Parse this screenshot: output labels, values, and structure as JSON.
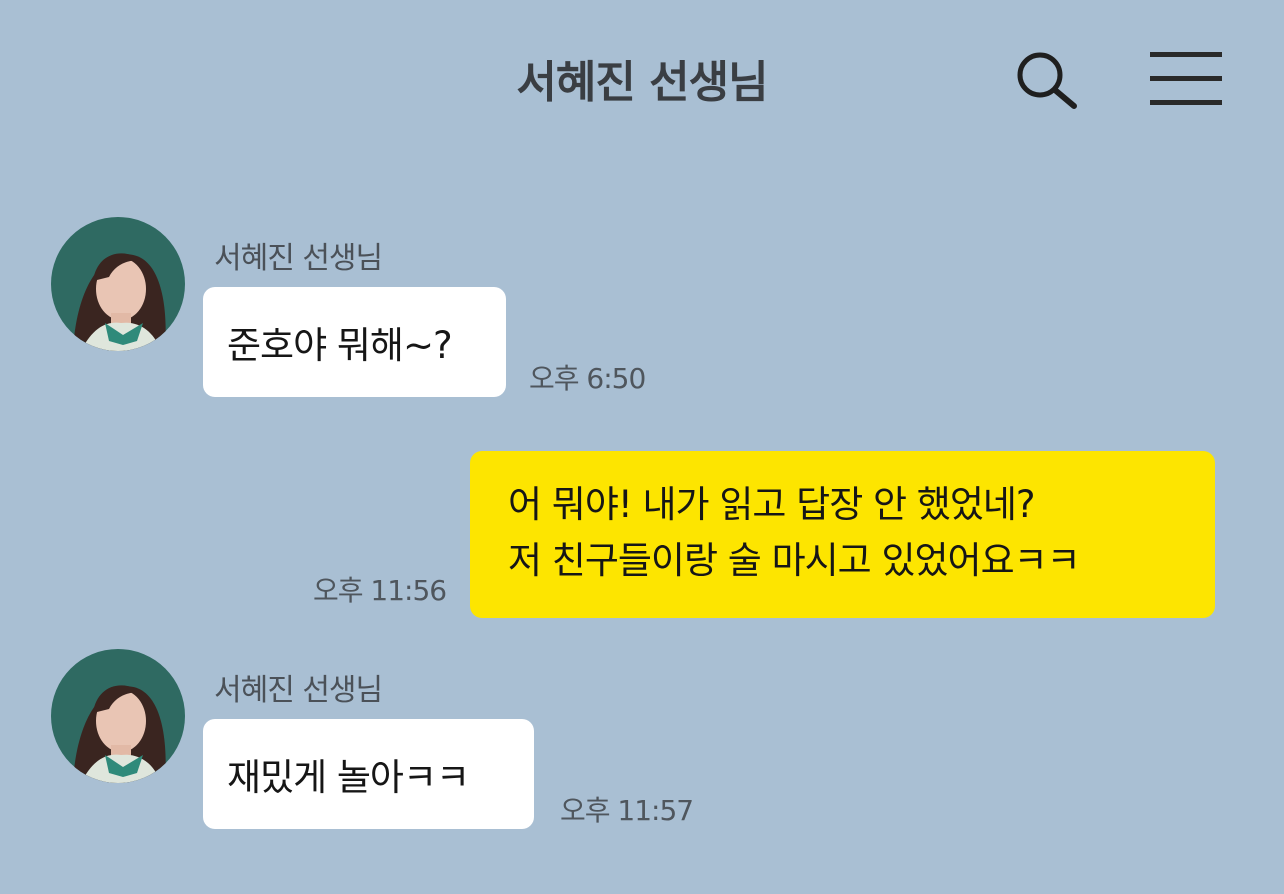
{
  "header": {
    "title": "서혜진 선생님",
    "search_icon": "search-icon",
    "menu_icon": "hamburger-menu-icon"
  },
  "colors": {
    "background": "#a9bfd3",
    "incoming_bubble": "#ffffff",
    "outgoing_bubble": "#fde500",
    "avatar_backdrop": "#2f6a62"
  },
  "messages": [
    {
      "direction": "incoming",
      "sender": "서혜진 선생님",
      "avatar_icon": "profile-photo",
      "text": "준호야 뭐해~?",
      "time": "오후 6:50"
    },
    {
      "direction": "outgoing",
      "lines": [
        "어 뭐야! 내가 읽고 답장 안 했었네?",
        "저 친구들이랑 술 마시고 있었어요ㅋㅋ"
      ],
      "time": "오후 11:56"
    },
    {
      "direction": "incoming",
      "sender": "서혜진 선생님",
      "avatar_icon": "profile-photo",
      "text": "재밌게 놀아ㅋㅋ",
      "time": "오후 11:57"
    }
  ]
}
